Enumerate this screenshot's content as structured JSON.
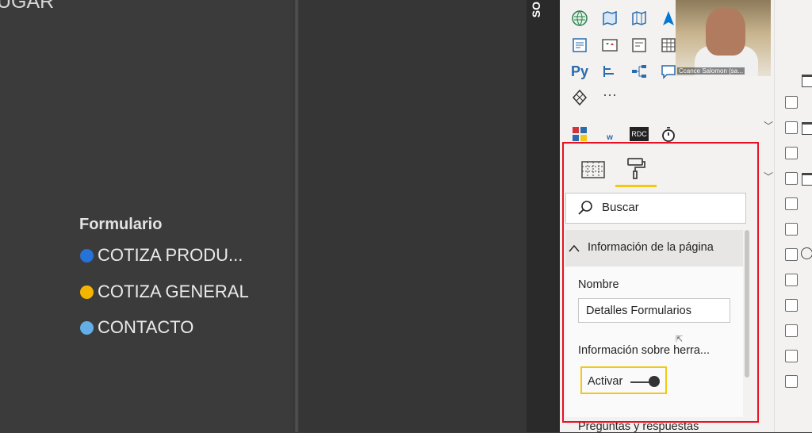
{
  "canvas": {
    "top_left_text": "UGAR",
    "vertical_text": "SO",
    "legend": {
      "title": "Formulario",
      "items": [
        {
          "label": "COTIZA PRODU...",
          "color": "#2672d6"
        },
        {
          "label": "COTIZA GENERAL",
          "color": "#f4b400"
        },
        {
          "label": "CONTACTO",
          "color": "#64aee8"
        }
      ]
    }
  },
  "visualizations": {
    "more_label": "···",
    "python_label": "Py",
    "custom_visual_label": "RDC"
  },
  "webcam": {
    "name": "Ccance Salomon (sa..."
  },
  "format_pane": {
    "search_placeholder": "Buscar",
    "section_title": "Información de la página",
    "name_label": "Nombre",
    "name_value": "Detalles Formularios",
    "tooltip_label": "Información sobre herra...",
    "toggle_label": "Activar",
    "toggle_state": "on",
    "next_section": "Preguntas y respuestas"
  },
  "colors": {
    "highlight_border": "#e81123",
    "accent": "#f2c811"
  }
}
